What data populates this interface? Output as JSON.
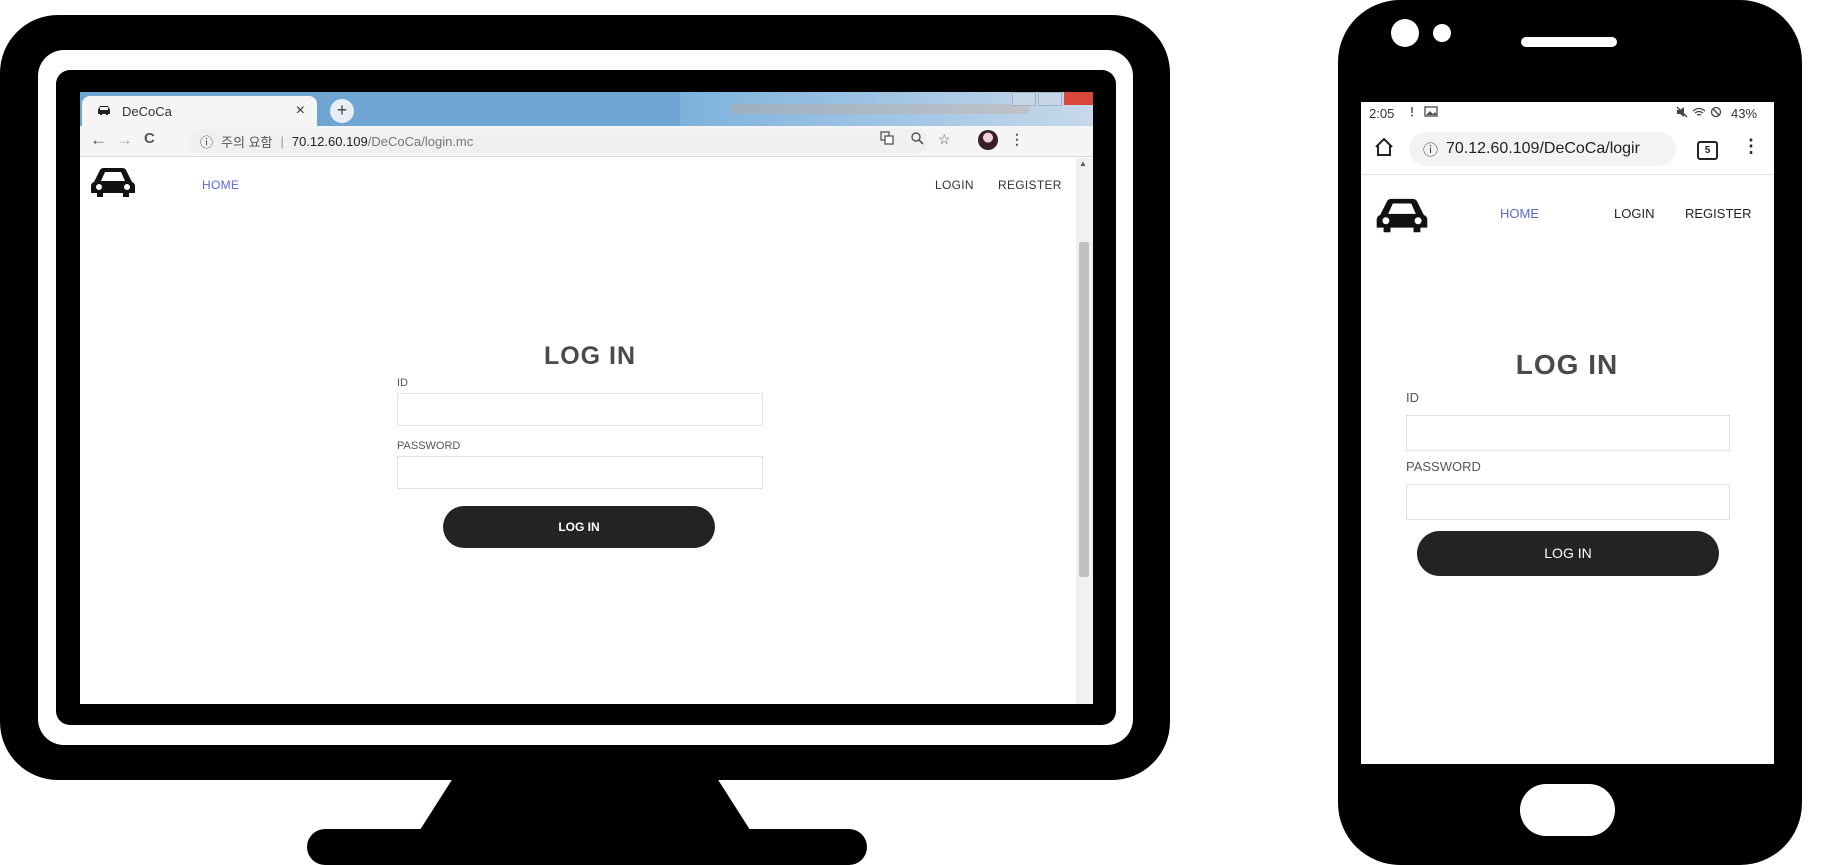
{
  "desktop": {
    "tab": {
      "title": "DeCoCa",
      "close_symbol": "×",
      "new_tab_symbol": "+"
    },
    "toolbar": {
      "back_symbol": "←",
      "forward_symbol": "→",
      "reload_symbol": "C",
      "security_warning": "주의 요함",
      "url_host": "70.12.60.109",
      "url_path": "/DeCoCa/login.mc"
    },
    "nav": {
      "home": "HOME",
      "login": "LOGIN",
      "register": "REGISTER"
    },
    "form": {
      "title": "LOG IN",
      "id_label": "ID",
      "id_value": "",
      "password_label": "PASSWORD",
      "password_value": "",
      "submit_label": "LOG IN"
    }
  },
  "phone": {
    "status_bar": {
      "time": "2:05",
      "battery": "43%"
    },
    "toolbar": {
      "url": "70.12.60.109/DeCoCa/logir",
      "tab_count": "5",
      "menu_symbol": "⋮"
    },
    "nav": {
      "home": "HOME",
      "login": "LOGIN",
      "register": "REGISTER"
    },
    "form": {
      "title": "LOG IN",
      "id_label": "ID",
      "id_value": "",
      "password_label": "PASSWORD",
      "password_value": "",
      "submit_label": "LOG IN"
    }
  },
  "colors": {
    "nav_active": "#5a6acf",
    "button_bg": "#232323",
    "tabstrip": "#6fa5d3"
  },
  "icons": [
    "car-logo-icon",
    "info-icon",
    "translate-icon",
    "zoom-icon",
    "star-icon",
    "profile-avatar",
    "home-icon",
    "tab-switcher-icon",
    "menu-icon"
  ]
}
